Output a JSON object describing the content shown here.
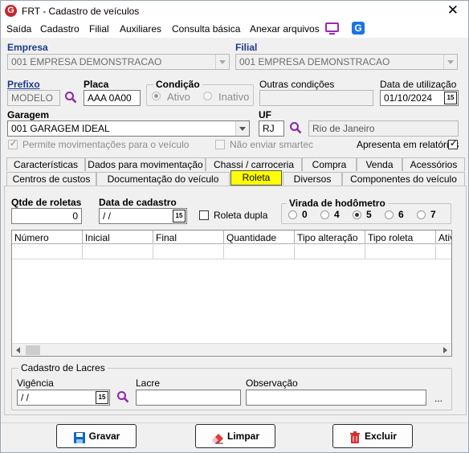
{
  "window": {
    "title": "FRT - Cadastro de veículos",
    "close_label": "✕",
    "app_icon_letter": "G"
  },
  "menu": {
    "items": [
      "Saída",
      "Cadastro",
      "Filial",
      "Auxiliares",
      "Consulta básica",
      "Anexar arquivos"
    ],
    "icons": [
      "monitor-icon",
      "google-icon"
    ],
    "google_letter": "G"
  },
  "empresa": {
    "label": "Empresa",
    "value": "001 EMPRESA DEMONSTRACAO"
  },
  "filial": {
    "label": "Filial",
    "value": "001 EMPRESA DEMONSTRACAO"
  },
  "prefixo": {
    "label": "Prefixo",
    "value": "MODELO"
  },
  "placa": {
    "label": "Placa",
    "value": "AAA 0A00"
  },
  "condicao": {
    "label": "Condição",
    "options": [
      "Ativo",
      "Inativo"
    ],
    "selected": "Ativo"
  },
  "outras_condicoes": {
    "label": "Outras condições",
    "value": ""
  },
  "data_utilizacao": {
    "label": "Data de utilização",
    "value": "01/10/2024"
  },
  "garagem": {
    "label": "Garagem",
    "value": "001 GARAGEM IDEAL"
  },
  "uf": {
    "label": "UF",
    "value": "RJ",
    "name": "Rio de Janeiro"
  },
  "checks": {
    "permite_mov": {
      "label": "Permite movimentações para o veículo",
      "checked": true,
      "enabled": false
    },
    "nao_enviar": {
      "label": "Não enviar smartec",
      "checked": false,
      "enabled": false
    },
    "apresenta": {
      "label": "Apresenta em relatórios",
      "checked": true,
      "enabled": true
    }
  },
  "tabs_row1": [
    "Características",
    "Dados para movimentação",
    "Chassi / carroceria",
    "Compra",
    "Venda",
    "Acessórios"
  ],
  "tabs_row2": [
    "Centros de custos",
    "Documentação do veículo",
    "Roleta",
    "Diversos",
    "Componentes do veículo"
  ],
  "active_tab": "Roleta",
  "roleta": {
    "qtde_label": "Qtde de roletas",
    "qtde_value": "0",
    "data_cadastro_label": "Data de cadastro",
    "data_cadastro_value": "/ /",
    "roleta_dupla_label": "Roleta dupla",
    "virada_label": "Virada de hodômetro",
    "virada_options": [
      "0",
      "4",
      "5",
      "6",
      "7"
    ],
    "virada_selected": "5"
  },
  "grid": {
    "columns": [
      "Número",
      "Inicial",
      "Final",
      "Quantidade",
      "Tipo alteração",
      "Tipo roleta",
      "Ativ"
    ],
    "rows": [
      [
        "",
        "",
        "",
        "",
        "",
        "",
        ""
      ]
    ]
  },
  "lacres": {
    "title": "Cadastro de Lacres",
    "vigencia_label": "Vigência",
    "vigencia_value": "/ /",
    "lacre_label": "Lacre",
    "lacre_value": "",
    "observacao_label": "Observação",
    "observacao_value": "",
    "ellipsis": "..."
  },
  "buttons": {
    "gravar": "Gravar",
    "limpar": "Limpar",
    "excluir": "Excluir"
  },
  "calendar_glyph": "15",
  "colors": {
    "active_tab": "#ffff00",
    "label_blue": "#1c3b8c",
    "search_purple": "#8e24aa",
    "brand_red": "#c6262e"
  }
}
